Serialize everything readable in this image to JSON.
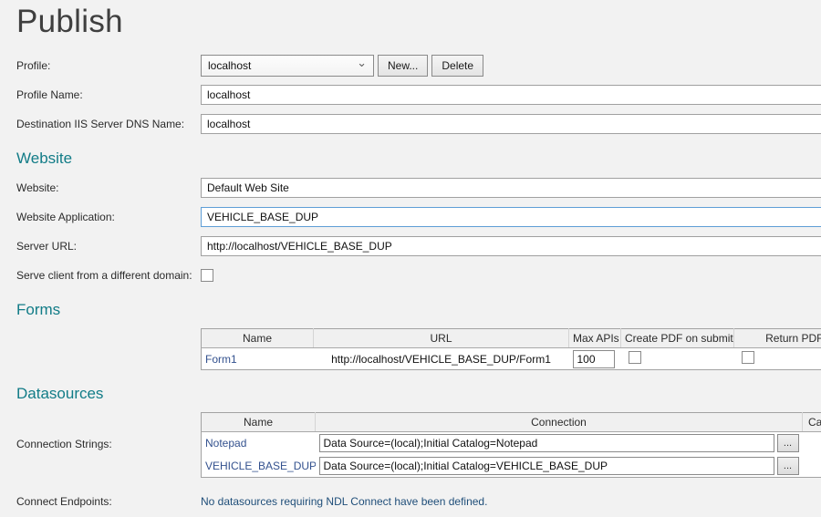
{
  "page": {
    "title": "Publish"
  },
  "colors": {
    "accent_teal": "#127c87",
    "link_navy": "#33518e",
    "message_blue": "#1f4e79",
    "focus_blue": "#5e9ed6"
  },
  "profile": {
    "label": "Profile:",
    "dropdown_value": "localhost",
    "new_button": "New...",
    "delete_button": "Delete"
  },
  "profile_name": {
    "label": "Profile Name:",
    "value": "localhost"
  },
  "destination_dns": {
    "label": "Destination IIS Server DNS Name:",
    "value": "localhost"
  },
  "website_section": {
    "heading": "Website",
    "website": {
      "label": "Website:",
      "value": "Default Web Site"
    },
    "application": {
      "label": "Website Application:",
      "value": "VEHICLE_BASE_DUP"
    },
    "server_url": {
      "label": "Server URL:",
      "value": "http://localhost/VEHICLE_BASE_DUP"
    },
    "serve_client": {
      "label": "Serve client from a different domain:",
      "checked": false
    }
  },
  "forms_section": {
    "heading": "Forms",
    "table": {
      "headers": [
        "Name",
        "URL",
        "Max APIs",
        "Create PDF on submit",
        "Return PDF URL"
      ],
      "rows": [
        {
          "name": "Form1",
          "url": "http://localhost/VEHICLE_BASE_DUP/Form1",
          "max_apis": "100",
          "create_pdf_checked": false,
          "return_pdf_checked": false
        }
      ]
    }
  },
  "datasources_section": {
    "heading": "Datasources",
    "connection_strings_label": "Connection Strings:",
    "table": {
      "headers": [
        "Name",
        "Connection",
        "Ca"
      ],
      "rows": [
        {
          "name": "Notepad",
          "connection": "Data Source=(local);Initial Catalog=Notepad",
          "browse": "..."
        },
        {
          "name": "VEHICLE_BASE_DUP",
          "connection": "Data Source=(local);Initial Catalog=VEHICLE_BASE_DUP",
          "browse": "..."
        }
      ]
    },
    "connect_endpoints_label": "Connect Endpoints:",
    "connect_endpoints_message": "No datasources requiring NDL Connect have been defined."
  }
}
